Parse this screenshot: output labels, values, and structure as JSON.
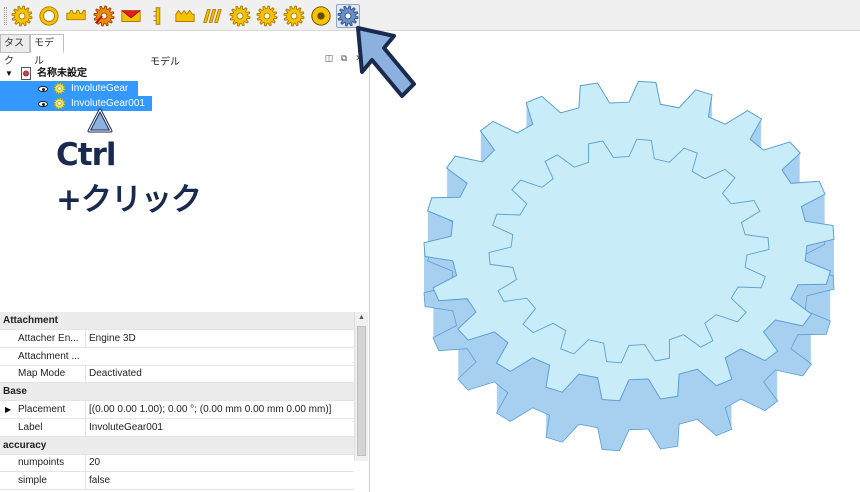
{
  "toolbar": {
    "tools": [
      {
        "icon": "gear-icon"
      },
      {
        "icon": "gear-ring-icon"
      },
      {
        "icon": "rack-icon"
      },
      {
        "icon": "cycloid-gear-icon"
      },
      {
        "icon": "crown-gear-icon"
      },
      {
        "icon": "bevel-gear-icon"
      },
      {
        "icon": "cycloid-rack-icon"
      },
      {
        "icon": "worm-gear-icon"
      },
      {
        "icon": "timing-gear-icon"
      },
      {
        "icon": "lantern-gear-icon"
      },
      {
        "icon": "hypo-cycloid-icon"
      },
      {
        "icon": "gear-connector-icon"
      },
      {
        "icon": "gear-distance-icon"
      }
    ],
    "colors": {
      "gear_yellow": "#f5c200",
      "gear_outline": "#b07a00",
      "gear_blue": "#6b8fc9"
    }
  },
  "tabs": [
    {
      "label": "タスク",
      "selected": false
    },
    {
      "label": "モデル",
      "selected": true
    }
  ],
  "panel": {
    "title": "モデル"
  },
  "tree": {
    "document": "名称未設定",
    "items": [
      {
        "label": "InvoluteGear",
        "selected": true
      },
      {
        "label": "InvoluteGear001",
        "selected": true
      }
    ]
  },
  "annotation": {
    "line1": "Ctrl",
    "line2": "+クリック",
    "color": "#1a2a4f",
    "arrow_color": "#8db1df"
  },
  "properties": [
    {
      "group": "Attachment"
    },
    {
      "key": "Attacher En...",
      "value": "Engine 3D"
    },
    {
      "key": "Attachment ...",
      "value": ""
    },
    {
      "key": "Map Mode",
      "value": "Deactivated"
    },
    {
      "group": "Base"
    },
    {
      "key": "Placement",
      "value": "[(0.00 0.00 1.00); 0.00 °; (0.00 mm  0.00 mm  0.00 mm)]",
      "expandable": true
    },
    {
      "key": "Label",
      "value": "InvoluteGear001"
    },
    {
      "group": "accuracy"
    },
    {
      "key": "numpoints",
      "value": "20"
    },
    {
      "key": "simple",
      "value": "false"
    }
  ],
  "viewport": {
    "gear_fill": "#c8ecf8",
    "gear_side": "#a7cff0",
    "gear_edge": "#5a9fd4"
  }
}
